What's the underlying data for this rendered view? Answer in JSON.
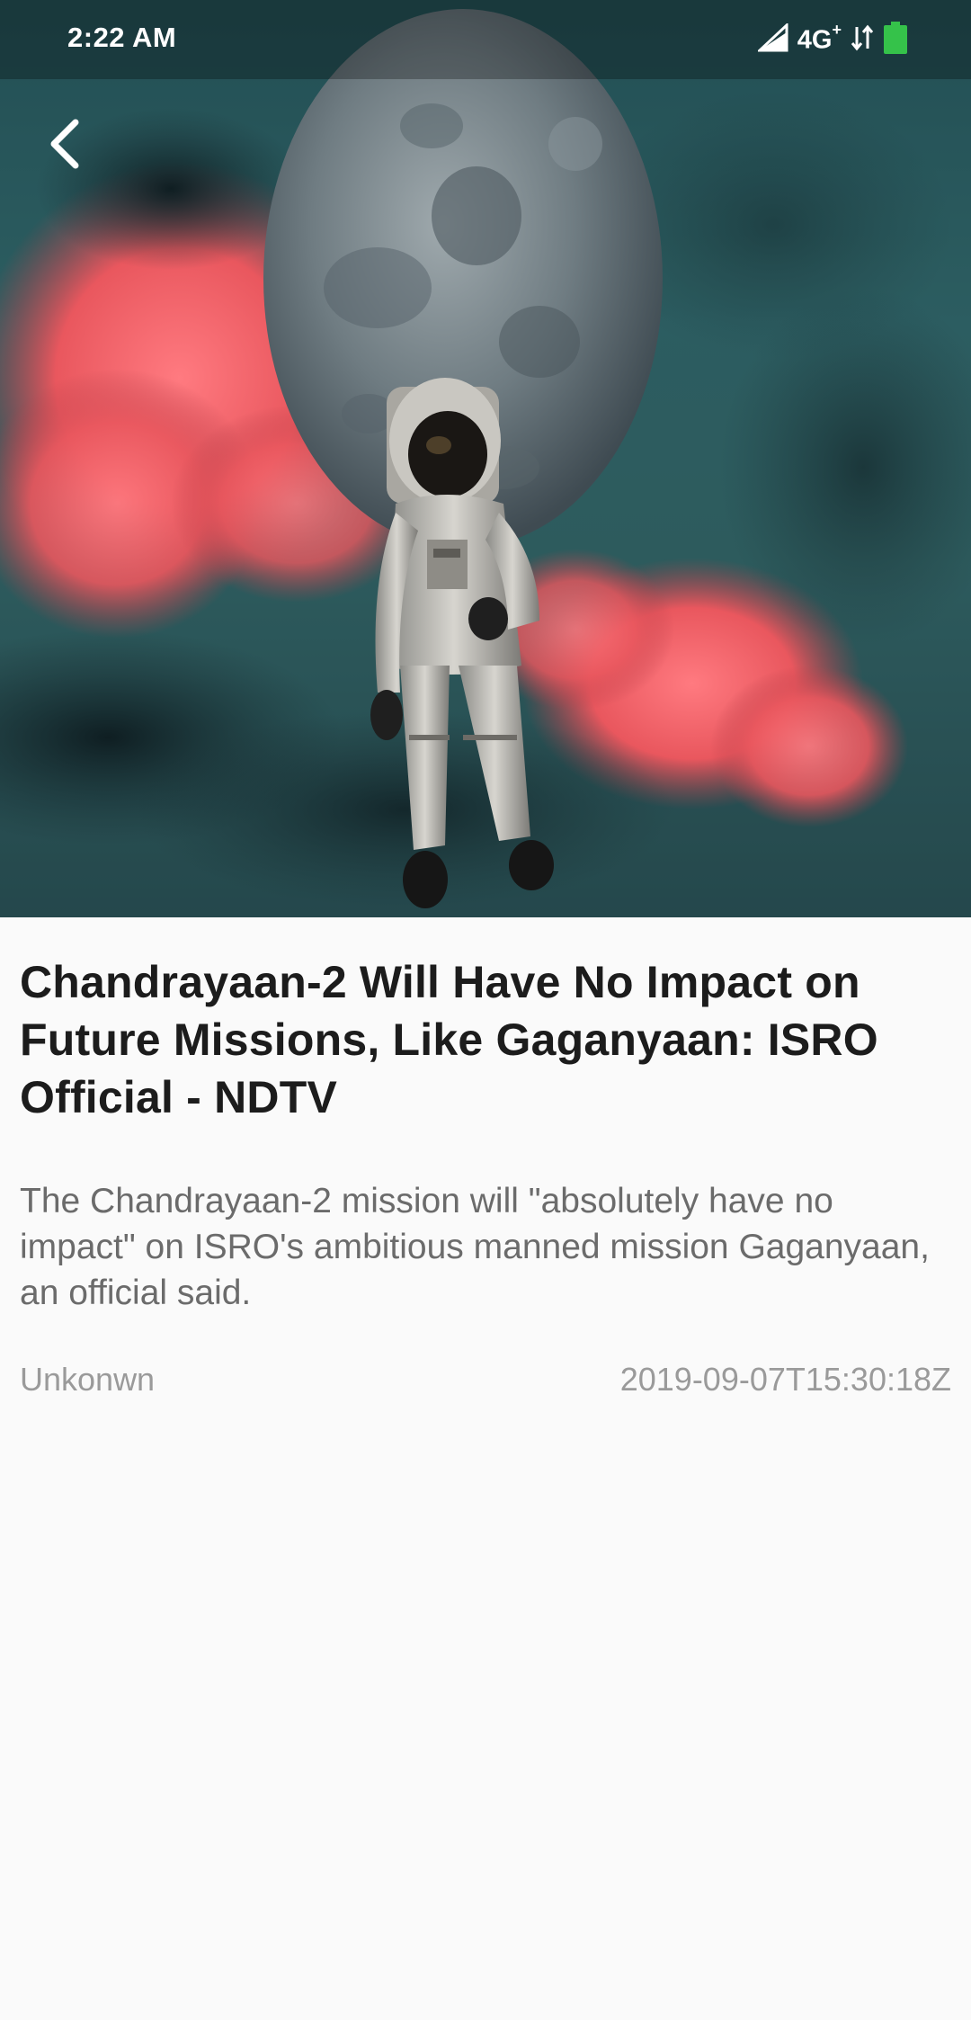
{
  "status_bar": {
    "time": "2:22 AM",
    "network": "4G",
    "network_plus": "+",
    "colors": {
      "battery": "#35c24a"
    }
  },
  "toolbar": {
    "back_icon": "chevron-left-icon"
  },
  "hero": {
    "image_icon": "astronaut-moon-image"
  },
  "article": {
    "title": "Chandrayaan-2 Will Have No Impact on Future Missions, Like Gaganyaan: ISRO Official - NDTV",
    "description": "The Chandrayaan-2 mission will \"absolutely have no impact\" on ISRO's ambitious manned mission Gaganyaan, an official said.",
    "author": "Unkonwn",
    "published_at": "2019-09-07T15:30:18Z"
  }
}
